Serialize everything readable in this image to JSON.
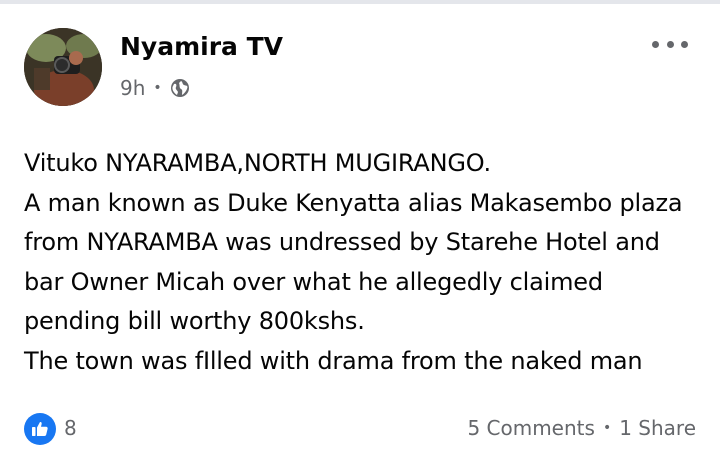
{
  "post": {
    "author": "Nyamira TV",
    "time": "9h",
    "separator": "•",
    "privacy_icon": "globe-icon",
    "more_icon": "more-options-icon",
    "text_lines": [
      "Vituko NYARAMBA,NORTH MUGIRANGO.",
      "A man known as Duke Kenyatta alias Makasembo plaza",
      "from NYARAMBA was undressed by Starehe Hotel and",
      "bar Owner Micah over what he allegedly claimed",
      "pending bill worthy 800kshs.",
      "The town was fIlled with drama from the naked man"
    ]
  },
  "footer": {
    "reaction_icon": "like-icon",
    "reaction_count": "8",
    "comments": "5 Comments",
    "separator": "•",
    "shares": "1 Share"
  },
  "colors": {
    "facebook_blue": "#1877f2",
    "secondary_text": "#65676b",
    "primary_text": "#050505"
  }
}
